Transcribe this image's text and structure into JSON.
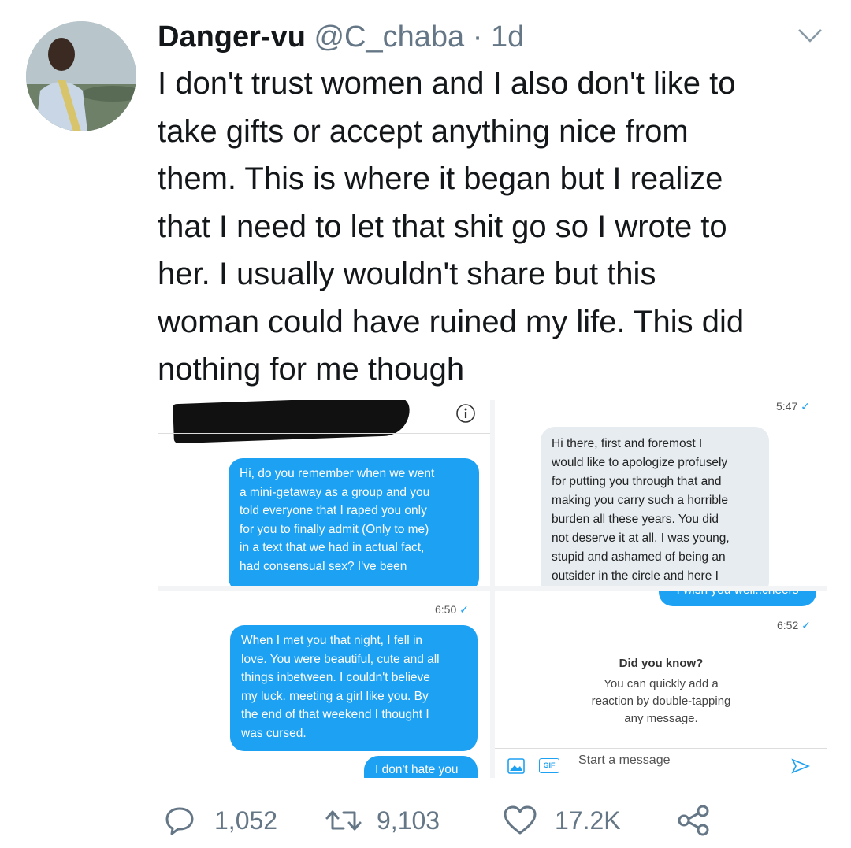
{
  "tweet": {
    "display_name": "Danger-vu",
    "handle": "@C_chaba",
    "separator": "·",
    "age": "1d",
    "text_lines": [
      "I don't trust women and I also don't  like to",
      "take gifts or accept  anything nice from",
      "them. This is where it began but I realize",
      "that I need to let that shit go so I wrote to",
      "her. I usually wouldn't share but this",
      "woman could have ruined my life. This did",
      "nothing for me though"
    ]
  },
  "media": {
    "panel1": {
      "message_lines": [
        "Hi, do you remember when we went",
        "a mini-getaway as a group and you",
        "told everyone that I raped you only",
        "for you to finally admit (Only to me)",
        "in a text that we had in actual fact,",
        "had consensual sex? I've been"
      ]
    },
    "panel2": {
      "time": "5:47",
      "message_lines": [
        "Hi there, first and foremost I",
        "would like to apologize profusely",
        "for putting you through that and",
        "making you carry such a horrible",
        "burden all these years. You did",
        "not deserve it at all. I was young,",
        "stupid and ashamed of being an",
        "outsider in the circle and here I"
      ]
    },
    "panel3": {
      "time": "6:50",
      "message_lines": [
        "When I met you that night, I fell in",
        "love. You were beautiful, cute and all",
        "things inbetween. I couldn't believe",
        "my luck. meeting a girl like you. By",
        "the end of that weekend I thought I",
        "was cursed."
      ],
      "partial_message": "I don't hate you"
    },
    "panel4": {
      "partial_message": "I wish you well..cheers",
      "time": "6:52",
      "tip_title": "Did you know?",
      "tip_lines": [
        "You can quickly add a",
        "reaction by double-tapping",
        "any message."
      ],
      "composer_placeholder": "Start a message",
      "gif_label": "GIF"
    }
  },
  "actions": {
    "replies": "1,052",
    "retweets": "9,103",
    "likes": "17.2K"
  },
  "colors": {
    "accent": "#1da1f2",
    "muted": "#657786",
    "text": "#14171a"
  }
}
